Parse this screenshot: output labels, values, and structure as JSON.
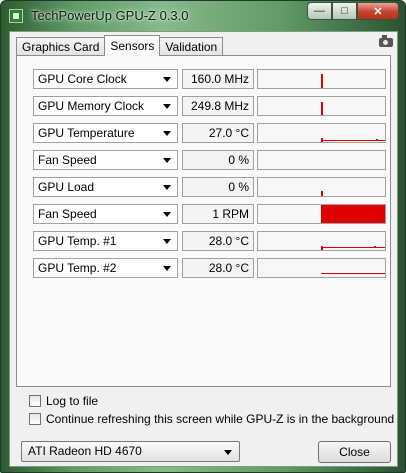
{
  "window": {
    "title": "TechPowerUp GPU-Z 0.3.0",
    "minimize_glyph": "—",
    "maximize_glyph": "□",
    "close_glyph": "✕"
  },
  "tabs": [
    {
      "label": "Graphics Card",
      "active": false
    },
    {
      "label": "Sensors",
      "active": true
    },
    {
      "label": "Validation",
      "active": false
    }
  ],
  "sensors": [
    {
      "name": "GPU Core Clock",
      "value": "160.0 MHz"
    },
    {
      "name": "GPU Memory Clock",
      "value": "249.8 MHz"
    },
    {
      "name": "GPU Temperature",
      "value": "27.0 °C"
    },
    {
      "name": "Fan Speed",
      "value": "0 %"
    },
    {
      "name": "GPU Load",
      "value": "0 %"
    },
    {
      "name": "Fan Speed",
      "value": "1 RPM"
    },
    {
      "name": "GPU Temp. #1",
      "value": "28.0 °C"
    },
    {
      "name": "GPU Temp. #2",
      "value": "28.0 °C"
    }
  ],
  "options": {
    "log_to_file": "Log to file",
    "continue_refresh": "Continue refreshing this screen while GPU-Z is in the background"
  },
  "footer": {
    "gpu_selected": "ATI Radeon HD 4670",
    "close_label": "Close"
  },
  "colors": {
    "graph_line": "#e00000"
  }
}
